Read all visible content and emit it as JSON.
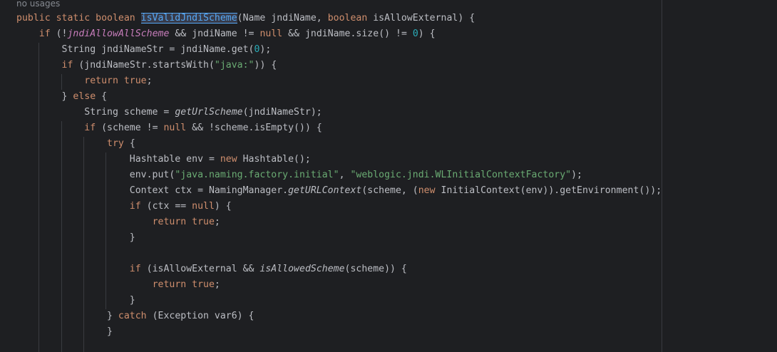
{
  "editor": {
    "usage_hint": "no usages",
    "lines": [
      [
        {
          "t": "public static boolean ",
          "c": "kw"
        },
        {
          "t": "isValidJndiScheme",
          "c": "fn hl"
        },
        {
          "t": "(Name jndiName, ",
          "c": "plain"
        },
        {
          "t": "boolean ",
          "c": "kw"
        },
        {
          "t": "isAllowExternal) {",
          "c": "plain"
        }
      ],
      [
        {
          "t": "    ",
          "c": "plain"
        },
        {
          "t": "if ",
          "c": "kw"
        },
        {
          "t": "(!",
          "c": "plain"
        },
        {
          "t": "jndiAllowAllScheme",
          "c": "field-static"
        },
        {
          "t": " && jndiName != ",
          "c": "plain"
        },
        {
          "t": "null",
          "c": "kw"
        },
        {
          "t": " && jndiName.size() != ",
          "c": "plain"
        },
        {
          "t": "0",
          "c": "num"
        },
        {
          "t": ") {",
          "c": "plain"
        }
      ],
      [
        {
          "t": "        String jndiNameStr = jndiName.get(",
          "c": "plain"
        },
        {
          "t": "0",
          "c": "num"
        },
        {
          "t": ");",
          "c": "plain"
        }
      ],
      [
        {
          "t": "        ",
          "c": "plain"
        },
        {
          "t": "if ",
          "c": "kw"
        },
        {
          "t": "(jndiNameStr.startsWith(",
          "c": "plain"
        },
        {
          "t": "\"java:\"",
          "c": "str"
        },
        {
          "t": ")) {",
          "c": "plain"
        }
      ],
      [
        {
          "t": "            ",
          "c": "plain"
        },
        {
          "t": "return true",
          "c": "kw"
        },
        {
          "t": ";",
          "c": "plain"
        }
      ],
      [
        {
          "t": "        } ",
          "c": "plain"
        },
        {
          "t": "else ",
          "c": "kw"
        },
        {
          "t": "{",
          "c": "plain"
        }
      ],
      [
        {
          "t": "            String scheme = ",
          "c": "plain"
        },
        {
          "t": "getUrlScheme",
          "c": "static-call"
        },
        {
          "t": "(jndiNameStr);",
          "c": "plain"
        }
      ],
      [
        {
          "t": "            ",
          "c": "plain"
        },
        {
          "t": "if ",
          "c": "kw"
        },
        {
          "t": "(scheme != ",
          "c": "plain"
        },
        {
          "t": "null",
          "c": "kw"
        },
        {
          "t": " && !scheme.isEmpty()) {",
          "c": "plain"
        }
      ],
      [
        {
          "t": "                ",
          "c": "plain"
        },
        {
          "t": "try ",
          "c": "kw"
        },
        {
          "t": "{",
          "c": "plain"
        }
      ],
      [
        {
          "t": "                    Hashtable env = ",
          "c": "plain"
        },
        {
          "t": "new ",
          "c": "kw"
        },
        {
          "t": "Hashtable();",
          "c": "plain"
        }
      ],
      [
        {
          "t": "                    env.put(",
          "c": "plain"
        },
        {
          "t": "\"java.naming.factory.initial\"",
          "c": "str"
        },
        {
          "t": ", ",
          "c": "plain"
        },
        {
          "t": "\"weblogic.jndi.WLInitialContextFactory\"",
          "c": "str"
        },
        {
          "t": ");",
          "c": "plain"
        }
      ],
      [
        {
          "t": "                    Context ctx = NamingManager.",
          "c": "plain"
        },
        {
          "t": "getURLContext",
          "c": "static-call"
        },
        {
          "t": "(scheme, (",
          "c": "plain"
        },
        {
          "t": "new ",
          "c": "kw"
        },
        {
          "t": "InitialContext(env)).getEnvironment());",
          "c": "plain"
        }
      ],
      [
        {
          "t": "                    ",
          "c": "plain"
        },
        {
          "t": "if ",
          "c": "kw"
        },
        {
          "t": "(ctx == ",
          "c": "plain"
        },
        {
          "t": "null",
          "c": "kw"
        },
        {
          "t": ") {",
          "c": "plain"
        }
      ],
      [
        {
          "t": "                        ",
          "c": "plain"
        },
        {
          "t": "return true",
          "c": "kw"
        },
        {
          "t": ";",
          "c": "plain"
        }
      ],
      [
        {
          "t": "                    }",
          "c": "plain"
        }
      ],
      [
        {
          "t": "",
          "c": "plain"
        }
      ],
      [
        {
          "t": "                    ",
          "c": "plain"
        },
        {
          "t": "if ",
          "c": "kw"
        },
        {
          "t": "(isAllowExternal && ",
          "c": "plain"
        },
        {
          "t": "isAllowedScheme",
          "c": "static-call"
        },
        {
          "t": "(scheme)) {",
          "c": "plain"
        }
      ],
      [
        {
          "t": "                        ",
          "c": "plain"
        },
        {
          "t": "return true",
          "c": "kw"
        },
        {
          "t": ";",
          "c": "plain"
        }
      ],
      [
        {
          "t": "                    }",
          "c": "plain"
        }
      ],
      [
        {
          "t": "                } ",
          "c": "plain"
        },
        {
          "t": "catch ",
          "c": "kw"
        },
        {
          "t": "(Exception var6) {",
          "c": "plain"
        }
      ],
      [
        {
          "t": "                }",
          "c": "plain"
        }
      ]
    ]
  },
  "colors": {
    "background": "#1e1f22",
    "keyword": "#cf8e6d",
    "method_declaration": "#56a8f5",
    "static_field": "#c77dbb",
    "string": "#6aab73",
    "number": "#2aacb8",
    "text": "#bcbec4"
  }
}
